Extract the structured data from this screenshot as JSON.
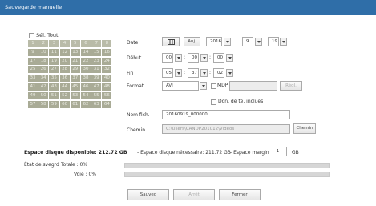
{
  "window": {
    "title": "Sauvegarde manuelle"
  },
  "select_all": {
    "label": "Sél. Tout"
  },
  "channels": [
    1,
    2,
    3,
    4,
    5,
    6,
    7,
    8,
    9,
    10,
    11,
    12,
    13,
    14,
    15,
    16,
    17,
    18,
    19,
    20,
    21,
    22,
    23,
    24,
    25,
    26,
    27,
    28,
    29,
    30,
    31,
    32,
    33,
    34,
    35,
    36,
    37,
    38,
    39,
    40,
    41,
    42,
    43,
    44,
    45,
    46,
    47,
    48,
    49,
    50,
    51,
    52,
    53,
    54,
    55,
    56,
    57,
    58,
    59,
    60,
    61,
    62,
    63,
    64
  ],
  "date": {
    "label": "Date",
    "today_label": "Auj.",
    "year": "2016",
    "month": "9",
    "day": "19"
  },
  "start": {
    "label": "Début",
    "hour": "00",
    "minute": "00",
    "second": "00"
  },
  "end": {
    "label": "Fin",
    "hour": "05",
    "minute": "37",
    "second": "02"
  },
  "format": {
    "label": "Format",
    "value": "AVI",
    "mdp_label": "MDP",
    "settings_label": "Régl.",
    "include_data_label": "Don. de te. inclues"
  },
  "filename": {
    "label": "Nom fich.",
    "value": "20160919_000000"
  },
  "path": {
    "label": "Chemin",
    "value": "C:\\Users\\CANDP201012\\Videos",
    "button_label": "Chemin"
  },
  "disk": {
    "available_label": "Espace disque disponible: 212.72 GB",
    "required_label": "- Espace disque nécessaire: 211.72 GB",
    "min_label": "- Espace marginal min:",
    "min_value": "1",
    "unit": "GB"
  },
  "progress": {
    "status_label": "État de svegrd",
    "total_label": "Totale : 0%",
    "total_percent": 0,
    "channel_label": "Voie : 0%",
    "channel_percent": 0
  },
  "buttons": {
    "save": "Sauveg",
    "stop": "Arrêt",
    "close": "Fermer"
  },
  "colors": {
    "titlebar": "#2f6ea8",
    "channel_cell": "#a9ab96",
    "progress_bar": "#d6d6d6"
  }
}
